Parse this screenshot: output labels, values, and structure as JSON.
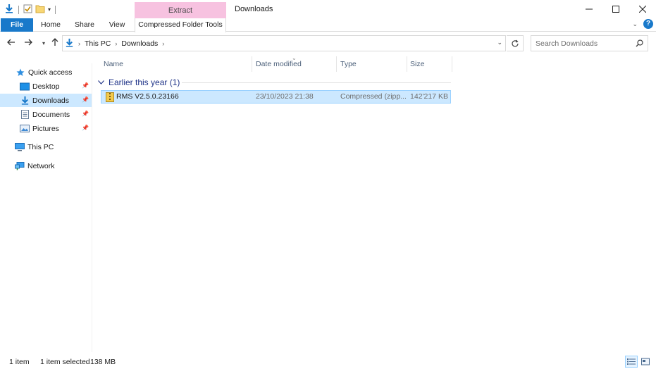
{
  "window": {
    "title": "Downloads",
    "context_tab_header": "Extract",
    "controls": [
      "minimize",
      "maximize",
      "close"
    ]
  },
  "ribbon": {
    "tabs": [
      {
        "label": "File"
      },
      {
        "label": "Home"
      },
      {
        "label": "Share"
      },
      {
        "label": "View"
      },
      {
        "label": "Compressed Folder Tools"
      }
    ]
  },
  "address_bar": {
    "crumbs": [
      "This PC",
      "Downloads"
    ]
  },
  "search": {
    "placeholder": "Search Downloads"
  },
  "sidebar": {
    "items": [
      {
        "label": "Quick access",
        "icon": "star-icon"
      },
      {
        "label": "Desktop",
        "icon": "desktop-folder-icon",
        "pinned": true
      },
      {
        "label": "Downloads",
        "icon": "download-arrow-icon",
        "pinned": true,
        "selected": true
      },
      {
        "label": "Documents",
        "icon": "documents-icon",
        "pinned": true
      },
      {
        "label": "Pictures",
        "icon": "pictures-icon",
        "pinned": true
      },
      {
        "label": "This PC",
        "icon": "computer-icon"
      },
      {
        "label": "Network",
        "icon": "network-icon"
      }
    ]
  },
  "columns": {
    "name": "Name",
    "date": "Date modified",
    "type": "Type",
    "size": "Size"
  },
  "group": {
    "label": "Earlier this year (1)"
  },
  "files": [
    {
      "name": "RMS V2.5.0.23166",
      "date": "23/10/2023 21:38",
      "type": "Compressed (zipp...",
      "size": "142'217 KB",
      "selected": true
    }
  ],
  "status": {
    "count": "1 item",
    "selected": "1 item selected",
    "size": "138 MB"
  },
  "colors": {
    "accent": "#1979ca",
    "selection": "#cce8ff",
    "context_tab": "#f7c2e0",
    "group_text": "#1e3287"
  }
}
